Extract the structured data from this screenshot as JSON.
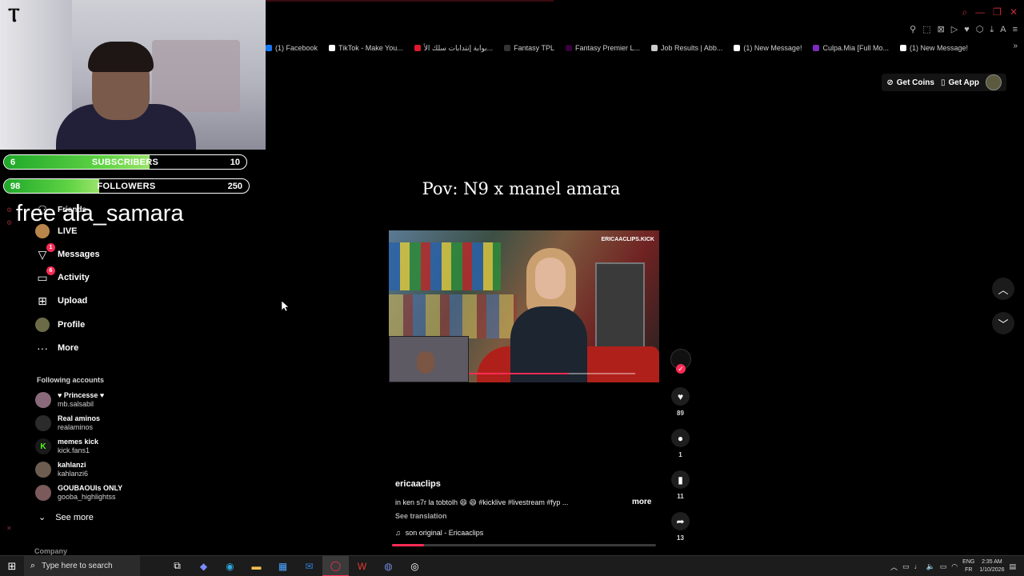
{
  "bookmarks": [
    {
      "label": "(1) Facebook",
      "color": "#1877f2"
    },
    {
      "label": "TikTok - Make You...",
      "color": "#ffffff"
    },
    {
      "label": "بوابة إنتدابات سلك الأ...",
      "color": "#e0192d"
    },
    {
      "label": "Fantasy TPL",
      "color": "#333333"
    },
    {
      "label": "Fantasy Premier L...",
      "color": "#38003c"
    },
    {
      "label": "Job Results | Abb...",
      "color": "#cccccc"
    },
    {
      "label": "(1) New Message!",
      "color": "#ffffff"
    },
    {
      "label": "Culpa.Mia [Full Mo...",
      "color": "#7b2cbf"
    },
    {
      "label": "(1) New Message!",
      "color": "#ffffff"
    }
  ],
  "stream": {
    "subscribers": {
      "left": "6",
      "label": "SUBSCRIBERS",
      "right": "10",
      "progress": 0.6
    },
    "followers": {
      "left": "98",
      "label": "FOLLOWERS",
      "right": "250",
      "progress": 0.39
    },
    "overlay_text": "free ala_samara"
  },
  "nav": {
    "friends": "Friends",
    "live": "LIVE",
    "messages": "Messages",
    "messages_badge": "1",
    "activity": "Activity",
    "activity_badge": "6",
    "upload": "Upload",
    "profile": "Profile",
    "more": "More"
  },
  "following": {
    "title": "Following accounts",
    "accounts": [
      {
        "display": "♥ Princesse ♥",
        "user": "mb.salsabil"
      },
      {
        "display": "Real aminos",
        "user": "realaminos"
      },
      {
        "display": "memes kick",
        "user": "kick.fans1"
      },
      {
        "display": "kahlanzi",
        "user": "kahlanzi6"
      },
      {
        "display": "GOUBAOUIs ONLY",
        "user": "gooba_highlightss"
      }
    ],
    "see_more": "See more",
    "company": "Company"
  },
  "top_actions": {
    "get_coins": "Get Coins",
    "get_app": "Get App"
  },
  "post": {
    "title": "Pov: N9 x manel amara",
    "video_watermark": "ERICAACLIPS.KICK",
    "likes": "89",
    "comments": "1",
    "saves": "11",
    "shares": "13",
    "username": "ericaaclips",
    "description": "in ken s7r la tobtolh 😄 😄 #kicklive #livestream #fyp ...",
    "more": "more",
    "see_translation": "See translation",
    "music": "son original - Ericaaclips",
    "progress": 0.12
  },
  "taskbar": {
    "search_placeholder": "Type here to search",
    "lang_top": "ENG",
    "lang_bottom": "FR",
    "time": "2:35 AM",
    "date": "1/10/2026"
  },
  "colors": {
    "accent": "#fe2c55",
    "bar_green": "#4cc93a"
  }
}
